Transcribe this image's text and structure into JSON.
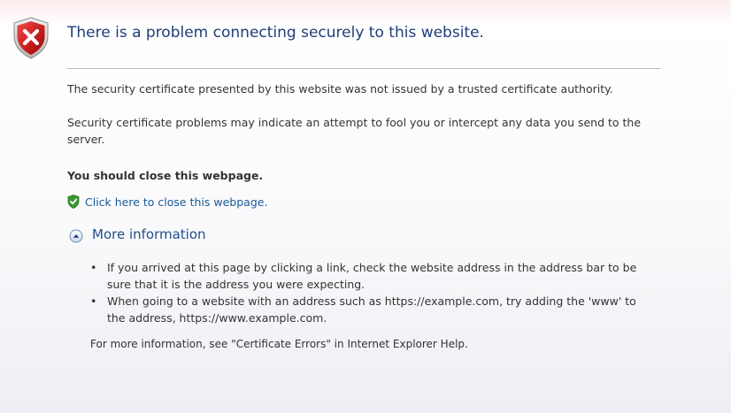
{
  "page": {
    "title": "There is a problem connecting securely to this website."
  },
  "body": {
    "para1": "The security certificate presented by this website was not issued by a trusted certificate authority.",
    "para2": "Security certificate problems may indicate an attempt to fool you or intercept any data you send to the server.",
    "recommendation": "You should close this webpage.",
    "close_link": "Click here to close this webpage."
  },
  "more_info": {
    "label": "More information",
    "bullet_char": "•",
    "bullets": [
      "If you arrived at this page by clicking a link, check the website address in the address bar to be sure that it is the address you were expecting.",
      "When going to a website with an address such as https://example.com, try adding the 'www' to the address, https://www.example.com."
    ],
    "footer": "For more information, see \"Certificate Errors\" in Internet Explorer Help."
  },
  "icons": {
    "error_shield": "error-shield-icon",
    "safe_shield": "green-shield-icon",
    "expand": "collapse-circle-icon"
  },
  "colors": {
    "title": "#1f3d7a",
    "link": "#1a5a96",
    "error_red": "#c8102e",
    "safe_green": "#3a9a2f"
  }
}
